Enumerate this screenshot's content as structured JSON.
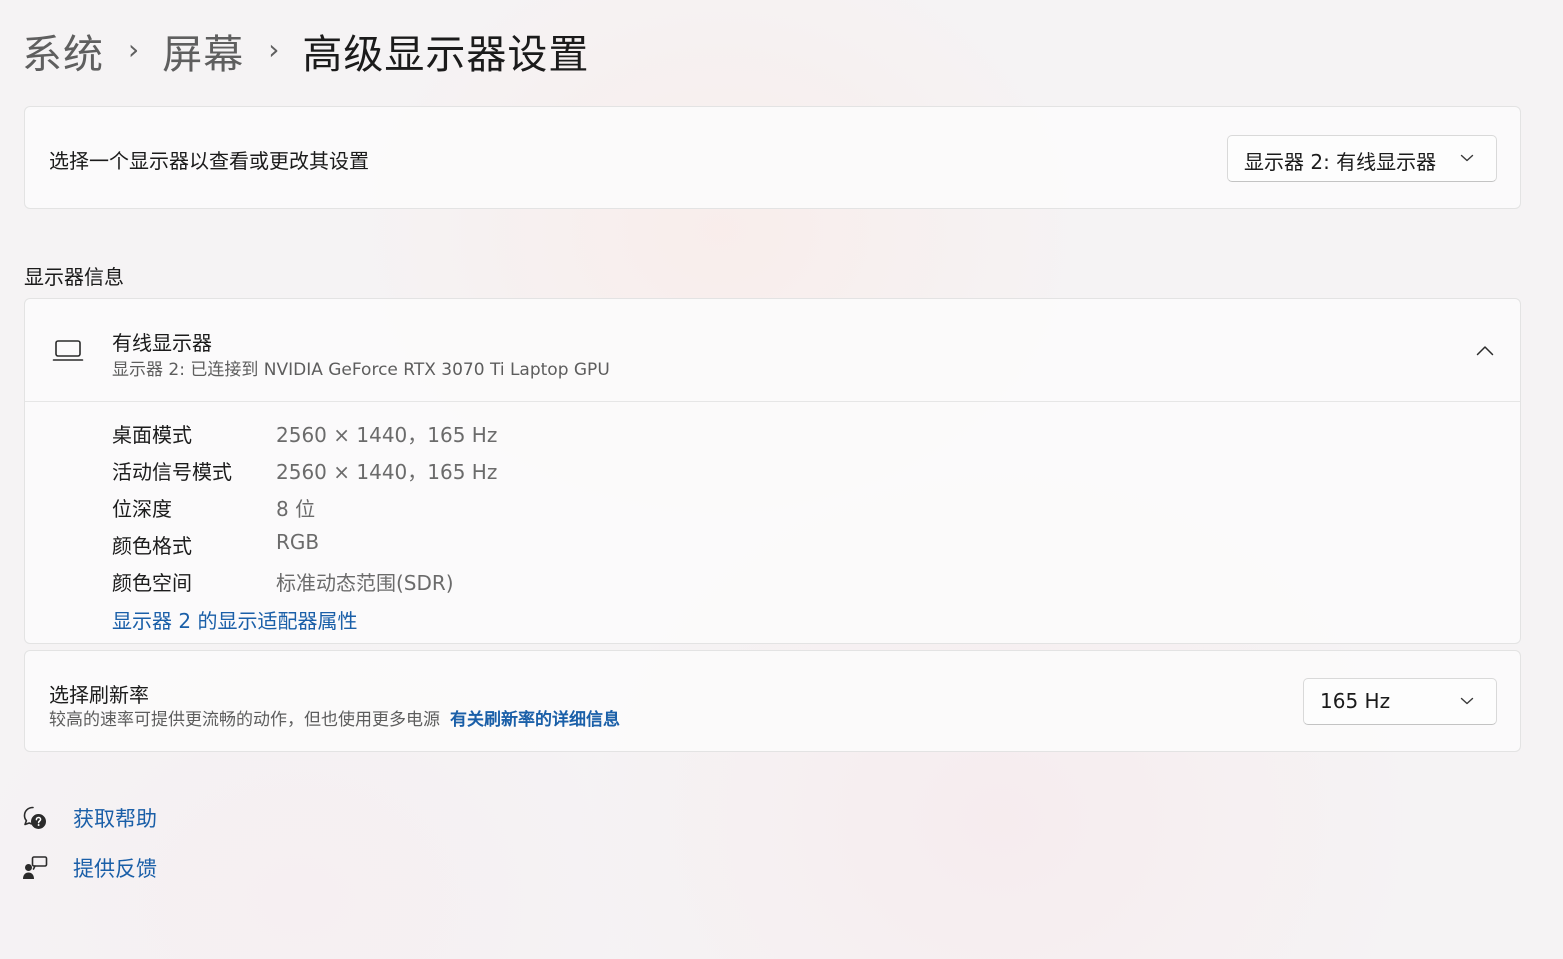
{
  "breadcrumb": {
    "items": [
      "系统",
      "屏幕"
    ],
    "separator": "›",
    "current": "高级显示器设置"
  },
  "select_monitor": {
    "label": "选择一个显示器以查看或更改其设置",
    "selected": "显示器 2: 有线显示器",
    "icon": "chevron-down-icon"
  },
  "display_info": {
    "section_title": "显示器信息",
    "monitor_name": "有线显示器",
    "monitor_subtitle": "显示器 2: 已连接到 NVIDIA GeForce RTX 3070 Ti Laptop GPU",
    "icon": "laptop-icon",
    "expanded": true,
    "rows": [
      {
        "key": "桌面模式",
        "value": "2560 × 1440，165 Hz"
      },
      {
        "key": "活动信号模式",
        "value": "2560 × 1440，165 Hz"
      },
      {
        "key": "位深度",
        "value": "8 位"
      },
      {
        "key": "颜色格式",
        "value": "RGB"
      },
      {
        "key": "颜色空间",
        "value": "标准动态范围(SDR)"
      }
    ],
    "adapter_link": "显示器 2 的显示适配器属性"
  },
  "refresh_rate": {
    "title": "选择刷新率",
    "description": "较高的速率可提供更流畅的动作，但也使用更多电源",
    "link": "有关刷新率的详细信息",
    "selected": "165 Hz"
  },
  "footer": {
    "help": "获取帮助",
    "feedback": "提供反馈"
  },
  "colors": {
    "accent_link": "#1a5fa8",
    "background": "#f5f3f4",
    "card": "#fbfbfb"
  }
}
